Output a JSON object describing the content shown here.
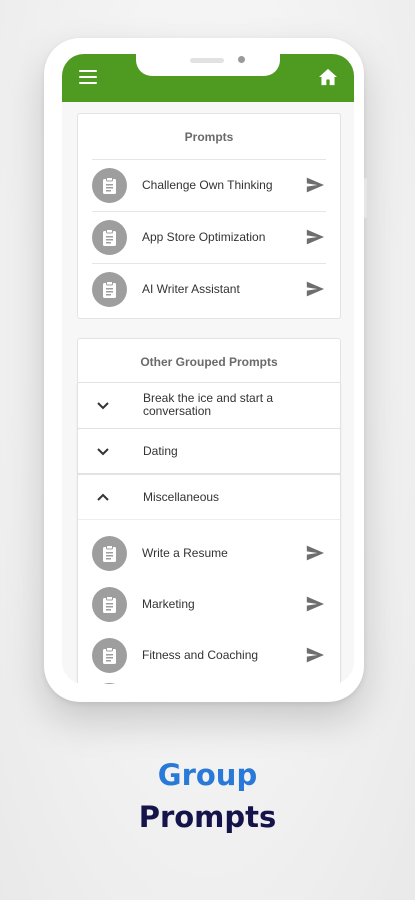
{
  "header": {
    "menu_icon": "hamburger-menu-icon",
    "home_icon": "home-icon",
    "color": "#4f9a20"
  },
  "prompts_card": {
    "title": "Prompts",
    "items": [
      {
        "label": "Challenge Own Thinking"
      },
      {
        "label": "App Store Optimization"
      },
      {
        "label": "AI Writer Assistant"
      }
    ]
  },
  "grouped_card": {
    "title": "Other Grouped Prompts",
    "groups": [
      {
        "label": "Break the ice and start a conversation",
        "expanded": false
      },
      {
        "label": "Dating",
        "expanded": false
      },
      {
        "label": "Miscellaneous",
        "expanded": true,
        "items": [
          {
            "label": "Write a Resume"
          },
          {
            "label": "Marketing"
          },
          {
            "label": "Fitness and Coaching"
          }
        ]
      }
    ]
  },
  "promo": {
    "line1": "Group",
    "line2": "Prompts",
    "line1_color": "#2979d8",
    "line2_color": "#14144a"
  }
}
